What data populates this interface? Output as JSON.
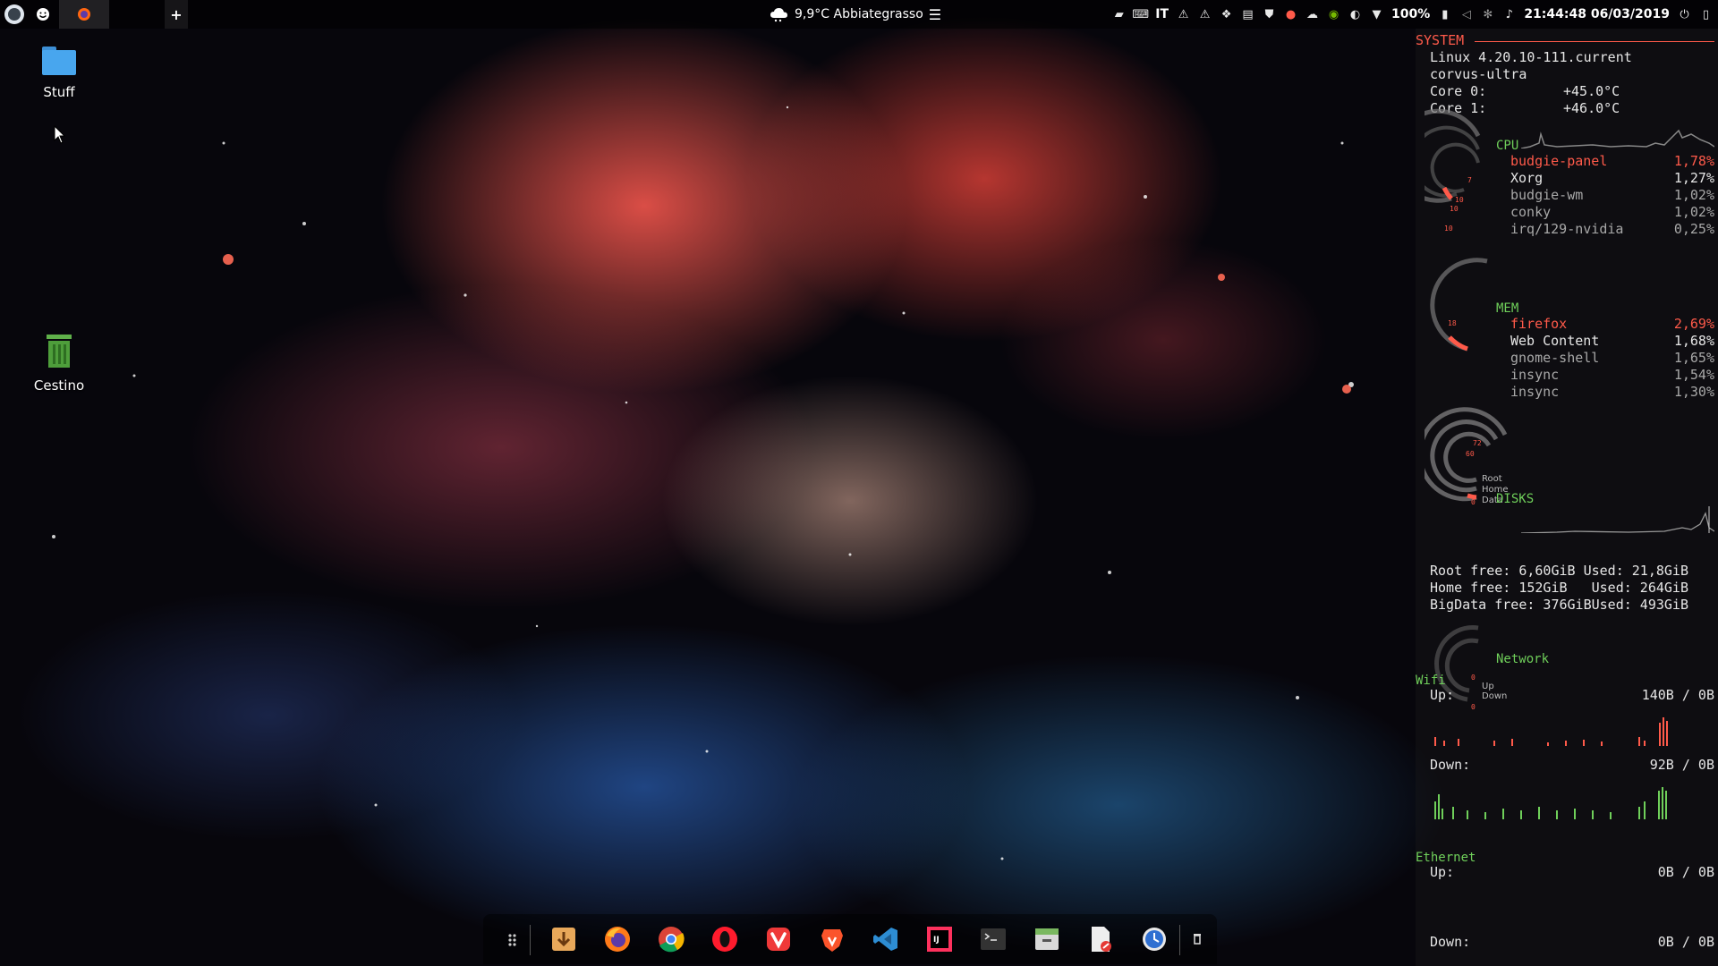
{
  "topbar": {
    "weather": "9,9°C Abbiategrasso",
    "keyboard_layout": "IT",
    "battery": "100%",
    "clock": "21:44:48 06/03/2019"
  },
  "desktop": {
    "icons": [
      {
        "label": "Stuff",
        "icon": "folder-icon"
      },
      {
        "label": "Cestino",
        "icon": "trash-icon"
      }
    ]
  },
  "conky": {
    "system": {
      "header": "SYSTEM",
      "kernel": "Linux 4.20.10-111.current",
      "hostname": "corvus-ultra",
      "core0_label": "Core 0:",
      "core0_temp": "+45.0°C",
      "core1_label": "Core 1:",
      "core1_temp": "+46.0°C"
    },
    "cpu": {
      "header": "CPU",
      "gauge_labels": [
        "7",
        "10",
        "10",
        "10"
      ],
      "processes": [
        {
          "name": "budgie-panel",
          "value": "1,78%"
        },
        {
          "name": "Xorg",
          "value": "1,27%"
        },
        {
          "name": "budgie-wm",
          "value": "1,02%"
        },
        {
          "name": "conky",
          "value": "1,02%"
        },
        {
          "name": "irq/129-nvidia",
          "value": "0,25%"
        }
      ]
    },
    "mem": {
      "header": "MEM",
      "gauge_label": "18",
      "processes": [
        {
          "name": "firefox",
          "value": "2,69%"
        },
        {
          "name": "Web Content",
          "value": "1,68%"
        },
        {
          "name": "gnome-shell",
          "value": "1,65%"
        },
        {
          "name": "insync",
          "value": "1,54%"
        },
        {
          "name": "insync",
          "value": "1,30%"
        }
      ]
    },
    "disks": {
      "header": "DISKS",
      "gauge_labels": [
        "72",
        "60",
        "0"
      ],
      "gauge_names": [
        "Root",
        "Home",
        "Data"
      ],
      "lines": [
        "Root free: 6,60GiB Used: 21,8GiB",
        "Home free: 152GiB   Used: 264GiB",
        "BigData free: 376GiBUsed: 493GiB"
      ]
    },
    "network": {
      "header": "Network",
      "gauge_labels": [
        "0",
        "0"
      ],
      "gauge_names": [
        "Up",
        "Down"
      ],
      "wifi": {
        "header": "Wifi",
        "up_label": "Up:",
        "up_value": "140B / 0B",
        "down_label": "Down:",
        "down_value": "92B / 0B"
      },
      "ethernet": {
        "header": "Ethernet",
        "up_label": "Up:",
        "up_value": "0B / 0B",
        "down_label": "Down:",
        "down_value": "0B / 0B"
      }
    }
  },
  "dock": {
    "items": [
      "app-grid-icon",
      "downloader-icon",
      "firefox-icon",
      "chrome-icon",
      "opera-icon",
      "vivaldi-icon",
      "brave-icon",
      "vscode-icon",
      "intellij-icon",
      "terminal-icon",
      "file-manager-icon",
      "document-viewer-icon",
      "clock-app-icon",
      "trash-icon"
    ]
  },
  "colors": {
    "conky_red": "#ff5a4a",
    "conky_green": "#6fcf5a"
  }
}
